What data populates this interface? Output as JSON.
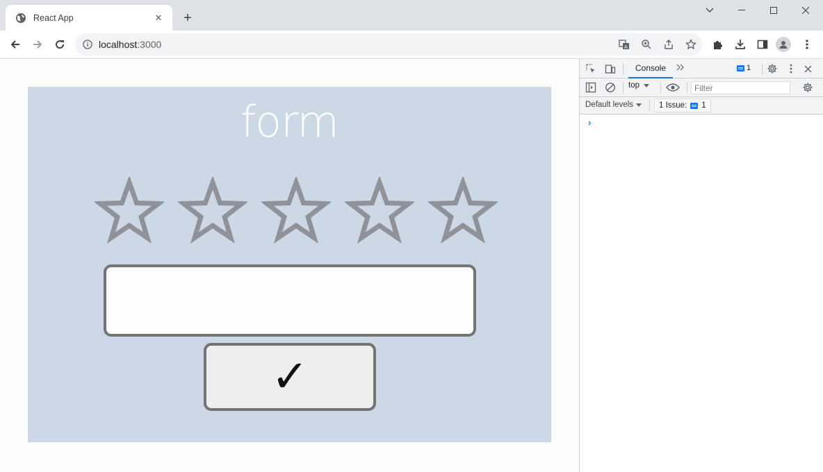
{
  "tab": {
    "title": "React App",
    "favicon": "globe-icon"
  },
  "toolbar": {
    "url_host": "localhost",
    "url_port": ":3000"
  },
  "form": {
    "title": "form",
    "rating": {
      "max": 5,
      "value": 0
    },
    "input_value": "",
    "submit_label": "✓"
  },
  "devtools": {
    "active_tab": "Console",
    "issue_badge_count": "1",
    "context": "top",
    "filter_placeholder": "Filter",
    "levels_label": "Default levels",
    "issues_label": "1 Issue:",
    "issues_count": "1",
    "prompt": "›"
  },
  "colors": {
    "card_bg": "#cdd8e6",
    "star_outline": "#8f9399",
    "accent": "#1a73e8"
  }
}
